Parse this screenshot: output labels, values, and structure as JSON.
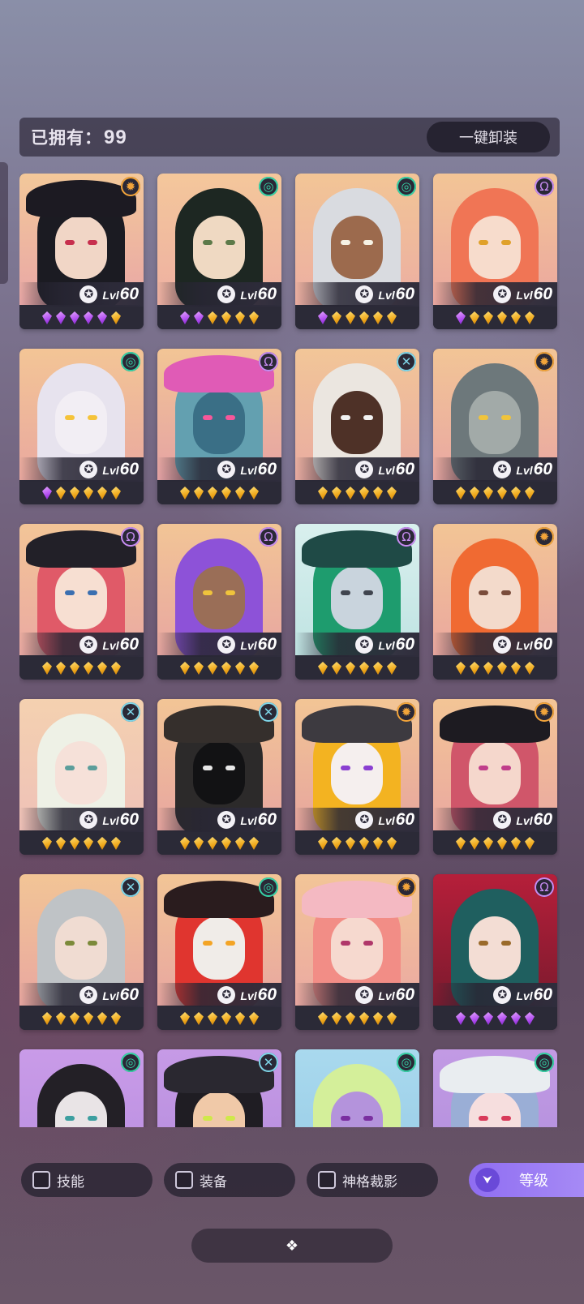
{
  "header": {
    "owned_label": "已拥有：",
    "owned_count": "99",
    "unequip_all_label": "一键卸装"
  },
  "level_label": "Lvl",
  "roster": [
    {
      "level": "60",
      "class": "sun",
      "bg": [
        "#f3c89a",
        "#e9a7a6"
      ],
      "hair": "#1b1b22",
      "skin": "#f1d6c6",
      "eye": "#c72f4d",
      "hat": "#1c1a22",
      "gems": [
        "purple",
        "purple",
        "purple",
        "purple",
        "purple",
        "gold"
      ]
    },
    {
      "level": "60",
      "class": "spiral",
      "bg": [
        "#f4c79b",
        "#eeb0a2"
      ],
      "hair": "#1d2722",
      "skin": "#efd9c2",
      "eye": "#5d7a49",
      "hat": null,
      "gems": [
        "purple",
        "purple",
        "gold",
        "gold",
        "gold",
        "gold"
      ]
    },
    {
      "level": "60",
      "class": "spiral",
      "bg": [
        "#f2c596",
        "#ecaea2"
      ],
      "hair": "#d9dbe0",
      "skin": "#9c6a4d",
      "eye": "#f6f2e4",
      "hat": null,
      "gems": [
        "purple",
        "gold",
        "gold",
        "gold",
        "gold",
        "gold"
      ]
    },
    {
      "level": "60",
      "class": "omega",
      "bg": [
        "#f3c596",
        "#eba79f"
      ],
      "hair": "#f07555",
      "skin": "#f7dccc",
      "eye": "#e0a12a",
      "hat": null,
      "gems": [
        "purple",
        "gold",
        "gold",
        "gold",
        "gold",
        "gold"
      ]
    },
    {
      "level": "60",
      "class": "spiral",
      "bg": [
        "#f3c596",
        "#e9a89f"
      ],
      "hair": "#e7e3ee",
      "skin": "#f2eef4",
      "eye": "#f5c33a",
      "hat": null,
      "gems": [
        "purple",
        "gold",
        "gold",
        "gold",
        "gold",
        "gold"
      ]
    },
    {
      "level": "60",
      "class": "omega",
      "bg": [
        "#f2c595",
        "#e5a2a4"
      ],
      "hair": "#63a0b0",
      "skin": "#3a6f86",
      "eye": "#f7579a",
      "hat": "#e05bb6",
      "gems": [
        "gold",
        "gold",
        "gold",
        "gold",
        "gold",
        "gold"
      ]
    },
    {
      "level": "60",
      "class": "cross",
      "bg": [
        "#f2c698",
        "#e9aba1"
      ],
      "hair": "#ebe6e0",
      "skin": "#4e3127",
      "eye": "#f2f2f2",
      "hat": null,
      "gems": [
        "gold",
        "gold",
        "gold",
        "gold",
        "gold",
        "gold"
      ]
    },
    {
      "level": "60",
      "class": "sun",
      "bg": [
        "#f2c596",
        "#e9a7a2"
      ],
      "hair": "#6d787b",
      "skin": "#a2aaa8",
      "eye": "#f0c43b",
      "hat": null,
      "gems": [
        "gold",
        "gold",
        "gold",
        "gold",
        "gold",
        "gold"
      ]
    },
    {
      "level": "60",
      "class": "omega",
      "bg": [
        "#f3c597",
        "#eaa9a2"
      ],
      "hair": "#e05a68",
      "skin": "#f7dfd2",
      "eye": "#3b6fb0",
      "hat": "#222028",
      "gems": [
        "gold",
        "gold",
        "gold",
        "gold",
        "gold",
        "gold"
      ]
    },
    {
      "level": "60",
      "class": "omega",
      "bg": [
        "#f2c596",
        "#e8a6a1"
      ],
      "hair": "#8d52d8",
      "skin": "#9a6e57",
      "eye": "#efc33c",
      "hat": null,
      "gems": [
        "gold",
        "gold",
        "gold",
        "gold",
        "gold",
        "gold"
      ]
    },
    {
      "level": "60",
      "class": "omega",
      "bg": [
        "#d9f0ee",
        "#bfe3e2"
      ],
      "hair": "#1e9c6e",
      "skin": "#c9d4dd",
      "eye": "#40454f",
      "hat": "#1f4a46",
      "gems": [
        "gold",
        "gold",
        "gold",
        "gold",
        "gold",
        "gold"
      ]
    },
    {
      "level": "60",
      "class": "sun",
      "bg": [
        "#f3c595",
        "#eaa79f"
      ],
      "hair": "#f06a32",
      "skin": "#f3dacb",
      "eye": "#7a4c3b",
      "hat": null,
      "gems": [
        "gold",
        "gold",
        "gold",
        "gold",
        "gold",
        "gold"
      ]
    },
    {
      "level": "60",
      "class": "cross",
      "bg": [
        "#f4d1b0",
        "#efc1b8"
      ],
      "hair": "#eef1e6",
      "skin": "#f6e1d9",
      "eye": "#5c9e9b",
      "hat": null,
      "gems": [
        "gold",
        "gold",
        "gold",
        "gold",
        "gold",
        "gold"
      ]
    },
    {
      "level": "60",
      "class": "cross",
      "bg": [
        "#f2c596",
        "#e8a6a0"
      ],
      "hair": "#2c2a2a",
      "skin": "#121214",
      "eye": "#e8e8e8",
      "hat": "#352f2c",
      "gems": [
        "gold",
        "gold",
        "gold",
        "gold",
        "gold",
        "gold"
      ]
    },
    {
      "level": "60",
      "class": "sun",
      "bg": [
        "#f2c595",
        "#e7a59e"
      ],
      "hair": "#f3b321",
      "skin": "#f5efee",
      "eye": "#8a3fd1",
      "hat": "#3d3a40",
      "gems": [
        "gold",
        "gold",
        "gold",
        "gold",
        "gold",
        "gold"
      ]
    },
    {
      "level": "60",
      "class": "sun",
      "bg": [
        "#f3c596",
        "#eaa8a0"
      ],
      "hair": "#d0566a",
      "skin": "#f5d7cc",
      "eye": "#c03d8a",
      "hat": "#1d1b21",
      "gems": [
        "gold",
        "gold",
        "gold",
        "gold",
        "gold",
        "gold"
      ]
    },
    {
      "level": "60",
      "class": "cross",
      "bg": [
        "#f2c596",
        "#e9a7a0"
      ],
      "hair": "#bfc3c6",
      "skin": "#f0dcd2",
      "eye": "#7b8a3a",
      "hat": null,
      "gems": [
        "gold",
        "gold",
        "gold",
        "gold",
        "gold",
        "gold"
      ]
    },
    {
      "level": "60",
      "class": "spiral",
      "bg": [
        "#f2c596",
        "#e8a6a0"
      ],
      "hair": "#e0352f",
      "skin": "#f0ece8",
      "eye": "#f3a425",
      "hat": "#2a1c1e",
      "gems": [
        "gold",
        "gold",
        "gold",
        "gold",
        "gold",
        "gold"
      ]
    },
    {
      "level": "60",
      "class": "sun",
      "bg": [
        "#f3c597",
        "#eba9a2"
      ],
      "hair": "#f28d86",
      "skin": "#f6d9cf",
      "eye": "#b0376a",
      "hat": "#f4b9c2",
      "gems": [
        "gold",
        "gold",
        "gold",
        "gold",
        "gold",
        "gold"
      ]
    },
    {
      "level": "60",
      "class": "omega",
      "bg": [
        "#b61f3a",
        "#7c1a2e"
      ],
      "hair": "#1f5f5f",
      "skin": "#f3ddd4",
      "eye": "#9a6a2a",
      "hat": null,
      "gems": [
        "purple",
        "purple",
        "purple",
        "purple",
        "purple",
        "purple"
      ]
    },
    {
      "level": "",
      "class": "spiral",
      "bg": [
        "#c99be8",
        "#b98fe0"
      ],
      "hair": "#232026",
      "skin": "#e9e4e6",
      "eye": "#3d9fa0",
      "hat": null,
      "gems": []
    },
    {
      "level": "",
      "class": "cross",
      "bg": [
        "#c69ae6",
        "#b58ddd"
      ],
      "hair": "#1f1d23",
      "skin": "#f0c9a8",
      "eye": "#cfe84a",
      "hat": "#2a2830",
      "gems": []
    },
    {
      "level": "",
      "class": "spiral",
      "bg": [
        "#a9d9ee",
        "#98cce6"
      ],
      "hair": "#d4ef9a",
      "skin": "#b493dc",
      "eye": "#7a2fa0",
      "hat": null,
      "gems": []
    },
    {
      "level": "",
      "class": "spiral",
      "bg": [
        "#c29ae4",
        "#b18fdc"
      ],
      "hair": "#9aaed6",
      "skin": "#f6dede",
      "eye": "#d83a5a",
      "hat": "#e9edf0",
      "gems": []
    }
  ],
  "class_colors": {
    "sun": "#f2a43a",
    "spiral": "#35d3a6",
    "omega": "#c78cf2",
    "cross": "#7fd6e8"
  },
  "class_glyphs": {
    "sun": "✹",
    "spiral": "◎",
    "omega": "Ω",
    "cross": "✕"
  },
  "level_glyph": "✪",
  "filters": [
    {
      "label": "技能"
    },
    {
      "label": "装备"
    },
    {
      "label": "神格裁影"
    }
  ],
  "sort": {
    "label": "等级",
    "icon": "chevrons-down-icon"
  },
  "collapse_icon": "diamond-cluster-icon"
}
